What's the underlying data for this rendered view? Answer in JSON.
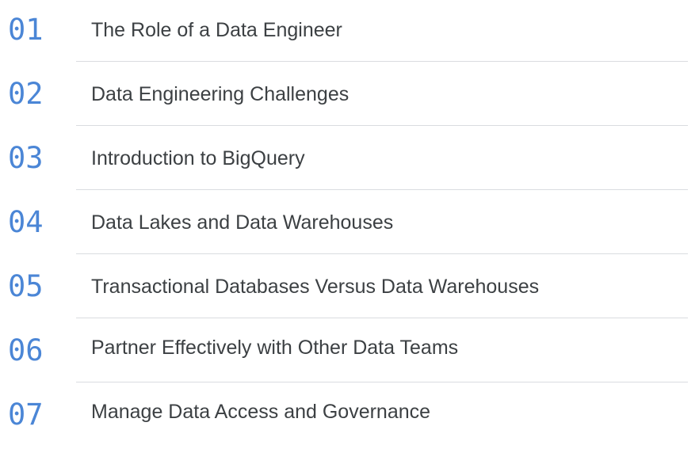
{
  "agenda": {
    "items": [
      {
        "number": "01",
        "title": "The Role of a Data Engineer"
      },
      {
        "number": "02",
        "title": "Data Engineering Challenges"
      },
      {
        "number": "03",
        "title": "Introduction to BigQuery"
      },
      {
        "number": "04",
        "title": "Data Lakes and Data Warehouses"
      },
      {
        "number": "05",
        "title": "Transactional Databases Versus Data Warehouses"
      },
      {
        "number": "06",
        "title": "Partner Effectively with Other Data Teams"
      },
      {
        "number": "07",
        "title": "Manage Data Access and Governance"
      }
    ]
  },
  "colors": {
    "number_accent": "#4b86d6",
    "title_text": "#3c4043",
    "divider": "#dadce0"
  }
}
